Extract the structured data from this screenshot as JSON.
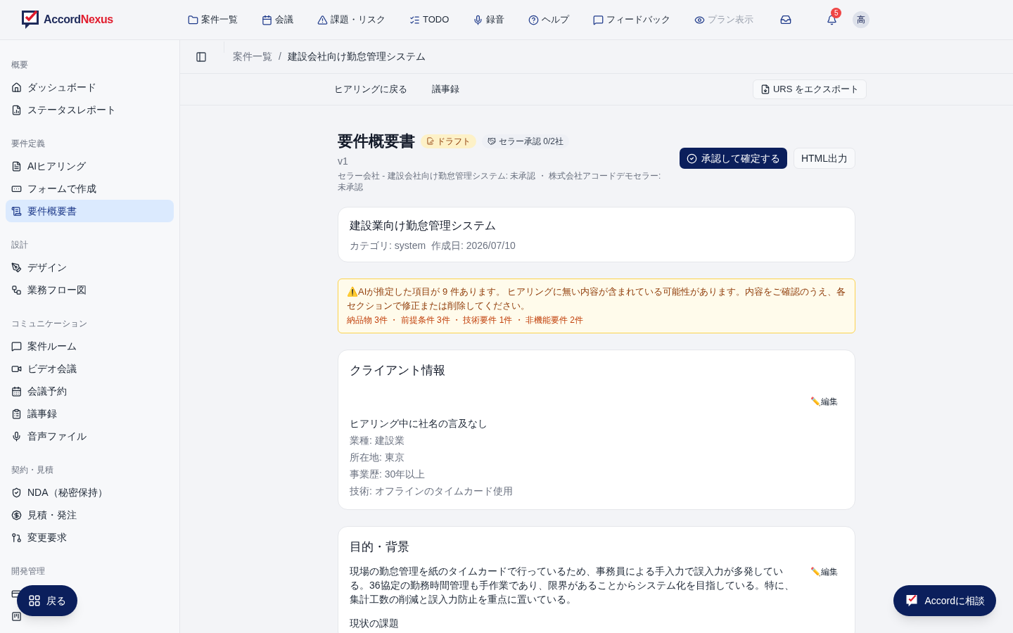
{
  "header": {
    "logo": {
      "part1": "Accord",
      "part2": "Nexus"
    },
    "nav": [
      {
        "kind": "folder",
        "label": "案件一覧",
        "disabled": false
      },
      {
        "kind": "calendar",
        "label": "会議",
        "disabled": false
      },
      {
        "kind": "warning",
        "label": "課題・リスク",
        "disabled": false
      },
      {
        "kind": "checklist",
        "label": "TODO",
        "disabled": false
      },
      {
        "kind": "mic",
        "label": "録音",
        "disabled": false
      },
      {
        "kind": "help",
        "label": "ヘルプ",
        "disabled": false
      },
      {
        "kind": "message",
        "label": "フィードバック",
        "disabled": false
      },
      {
        "kind": "eye",
        "label": "プラン表示",
        "disabled": true
      }
    ],
    "notifications": "5",
    "avatar": "高"
  },
  "sidebar": {
    "sections": [
      {
        "title": "概要",
        "items": [
          {
            "kind": "home",
            "label": "ダッシュボード",
            "selected": false
          },
          {
            "kind": "report",
            "label": "ステータスレポート",
            "selected": false
          }
        ]
      },
      {
        "title": "要件定義",
        "items": [
          {
            "kind": "doc",
            "label": "AIヒアリング",
            "selected": false
          },
          {
            "kind": "form",
            "label": "フォームで作成",
            "selected": false
          },
          {
            "kind": "scroll",
            "label": "要件概要書",
            "selected": true
          }
        ]
      },
      {
        "title": "設計",
        "items": [
          {
            "kind": "pen",
            "label": "デザイン",
            "selected": false
          },
          {
            "kind": "flow",
            "label": "業務フロー図",
            "selected": false
          }
        ]
      },
      {
        "title": "コミュニケーション",
        "items": [
          {
            "kind": "chat",
            "label": "案件ルーム",
            "selected": false
          },
          {
            "kind": "video",
            "label": "ビデオ会議",
            "selected": false
          },
          {
            "kind": "calendar",
            "label": "会議予約",
            "selected": false
          },
          {
            "kind": "clipboard",
            "label": "議事録",
            "selected": false
          },
          {
            "kind": "mic",
            "label": "音声ファイル",
            "selected": false
          }
        ]
      },
      {
        "title": "契約・見積",
        "items": [
          {
            "kind": "shield",
            "label": "NDA（秘密保持）",
            "selected": false
          },
          {
            "kind": "dollar",
            "label": "見積・発注",
            "selected": false
          },
          {
            "kind": "branch",
            "label": "変更要求",
            "selected": false
          }
        ]
      },
      {
        "title": "開発管理",
        "items": [
          {
            "kind": "board",
            "selected": false
          },
          {
            "kind": "kanban",
            "selected": false
          }
        ]
      }
    ]
  },
  "breadcrumb": {
    "items": [
      "案件一覧",
      "建設会社向け勤怠管理システム"
    ],
    "separator": "/"
  },
  "toolbar": {
    "links": [
      "ヒアリングに戻る",
      "議事録"
    ],
    "export": "URS をエクスポート"
  },
  "document": {
    "title": "要件概要書",
    "status": "ドラフト",
    "approval": "セラー承認 0/2社",
    "version": "v1",
    "approvers": "セラー会社 - 建設会社向け勤怠管理システム: 未承認 ・ 株式会社アコードデモセラー: 未承認",
    "approve_button": "承認して確定する",
    "html_button": "HTML出力"
  },
  "summary": {
    "title": "建設業向け勤怠管理システム",
    "meta": "カテゴリ: system  作成日: 2026/07/10"
  },
  "warning": {
    "message": "⚠️AIが推定した項目が 9 件あります。 ヒアリングに無い内容が含まれている可能性があります。内容をご確認のうえ、各セクションで修正または削除してください。",
    "counts": "納品物 3件 ・ 前提条件 3件 ・ 技術要件 1件 ・ 非機能要件 2件"
  },
  "sections": [
    {
      "title": "クライアント情報",
      "edit": "✏️編集",
      "lead": "ヒアリング中に社名の言及なし",
      "lines": [
        "業種: 建設業",
        "所在地: 東京",
        "事業歴: 30年以上",
        "技術: オフラインのタイムカード使用"
      ]
    },
    {
      "title": "目的・背景",
      "edit": "✏️編集",
      "body": "現場の勤怠管理を紙のタイムカードで行っているため、事務員による手入力で誤入力が多発している。36協定の勤務時間管理も手作業であり、限界があることからシステム化を目指している。特に、集計工数の削減と誤入力防止を重点に置いている。",
      "subheading": "現状の課題"
    }
  ],
  "floating": {
    "back": "戻る",
    "consult": "Accordに相談"
  }
}
